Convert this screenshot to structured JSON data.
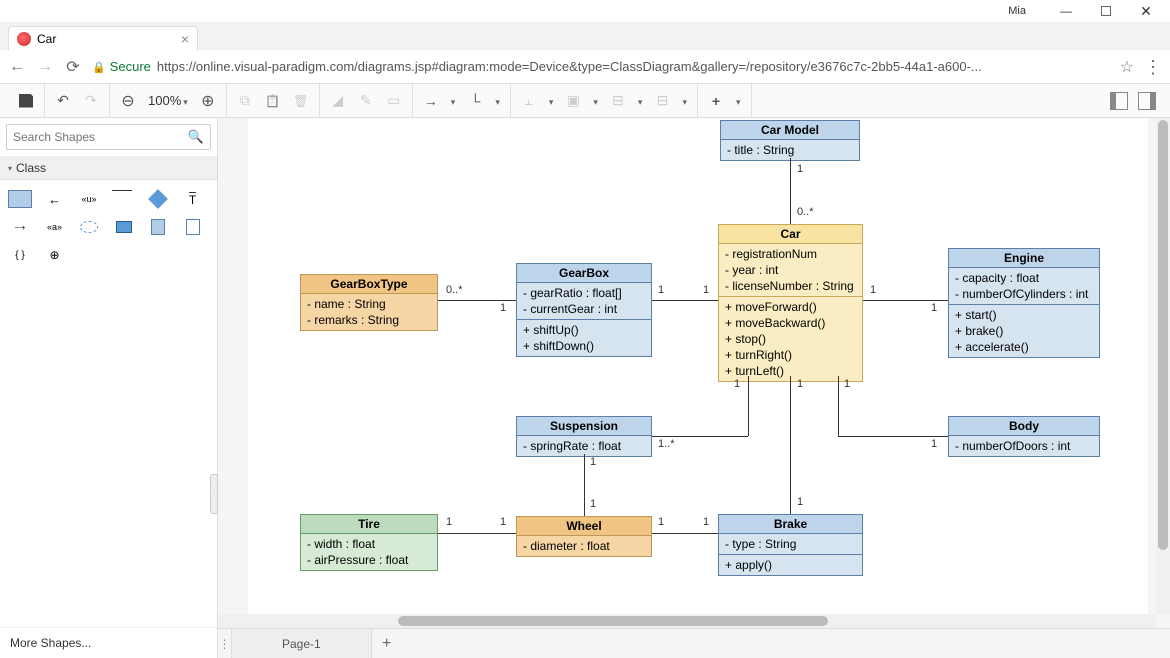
{
  "window": {
    "user": "Mia"
  },
  "browser": {
    "tab_title": "Car",
    "secure_label": "Secure",
    "url": "https://online.visual-paradigm.com/diagrams.jsp#diagram:mode=Device&type=ClassDiagram&gallery=/repository/e3676c7c-2bb5-44a1-a600-..."
  },
  "toolbar": {
    "zoom": "100%"
  },
  "sidebar": {
    "search_placeholder": "Search Shapes",
    "panel": "Class",
    "more_shapes": "More Shapes..."
  },
  "page_tab": "Page-1",
  "diagram": {
    "classes": {
      "carModel": {
        "name": "Car Model",
        "attrs": [
          "- title : String"
        ]
      },
      "car": {
        "name": "Car",
        "attrs": [
          "- registrationNum",
          "- year : int",
          "- licenseNumber : String"
        ],
        "ops": [
          "+ moveForward()",
          "+ moveBackward()",
          "+ stop()",
          "+ turnRight()",
          "+ turnLeft()"
        ]
      },
      "engine": {
        "name": "Engine",
        "attrs": [
          "- capacity : float",
          "- numberOfCylinders : int"
        ],
        "ops": [
          "+ start()",
          "+ brake()",
          "+ accelerate()"
        ]
      },
      "gearbox": {
        "name": "GearBox",
        "attrs": [
          "- gearRatio : float[]",
          "- currentGear : int"
        ],
        "ops": [
          "+ shiftUp()",
          "+ shiftDown()"
        ]
      },
      "gearboxType": {
        "name": "GearBoxType",
        "attrs": [
          "- name : String",
          "- remarks : String"
        ]
      },
      "suspension": {
        "name": "Suspension",
        "attrs": [
          "- springRate : float"
        ]
      },
      "body": {
        "name": "Body",
        "attrs": [
          "- numberOfDoors : int"
        ]
      },
      "tire": {
        "name": "Tire",
        "attrs": [
          "- width : float",
          "- airPressure : float"
        ]
      },
      "wheel": {
        "name": "Wheel",
        "attrs": [
          "- diameter : float"
        ]
      },
      "brake": {
        "name": "Brake",
        "attrs": [
          "- type : String"
        ],
        "ops": [
          "+ apply()"
        ]
      }
    },
    "multiplicities": {
      "carModel_car_a": "1",
      "carModel_car_b": "0..*",
      "gearboxType_gearbox_a": "0..*",
      "gearboxType_gearbox_b": "1",
      "gearbox_car_a": "1",
      "gearbox_car_b": "1",
      "car_engine_a": "1",
      "car_engine_b": "1",
      "car_suspension_a": "1",
      "car_suspension_b": "1..*",
      "car_brake_a": "1",
      "car_brake_b": "1",
      "car_body_a": "1",
      "car_body_b": "1",
      "suspension_wheel_a": "1",
      "suspension_wheel_b": "1",
      "tire_wheel_a": "1",
      "tire_wheel_b": "1",
      "wheel_brake_a": "1",
      "wheel_brake_b": "1"
    }
  }
}
